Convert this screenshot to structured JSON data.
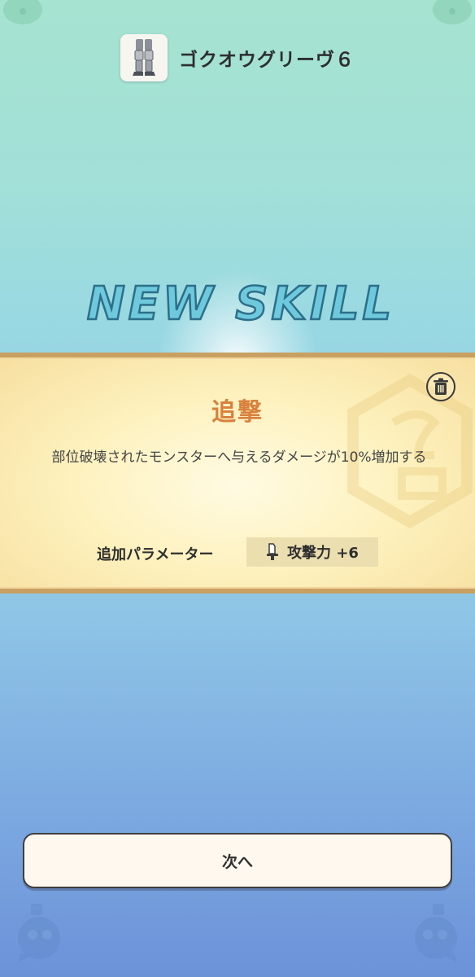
{
  "header": {
    "item_name": "ゴクオウグリーヴ６",
    "item_icon": "greaves-icon"
  },
  "banner_title": "NEW SKILL",
  "skill": {
    "name": "追撃",
    "description": "部位破壊されたモンスターへ与えるダメージが10%増加する",
    "param_label": "追加パラメーター",
    "param_value": "攻撃力 +6",
    "param_icon": "sword-icon"
  },
  "actions": {
    "trash_icon": "trash-icon",
    "next_label": "次へ"
  },
  "colors": {
    "skill_name": "#d9803d",
    "banner_border": "#c8a062",
    "title_fill": "#6ec9dc"
  }
}
